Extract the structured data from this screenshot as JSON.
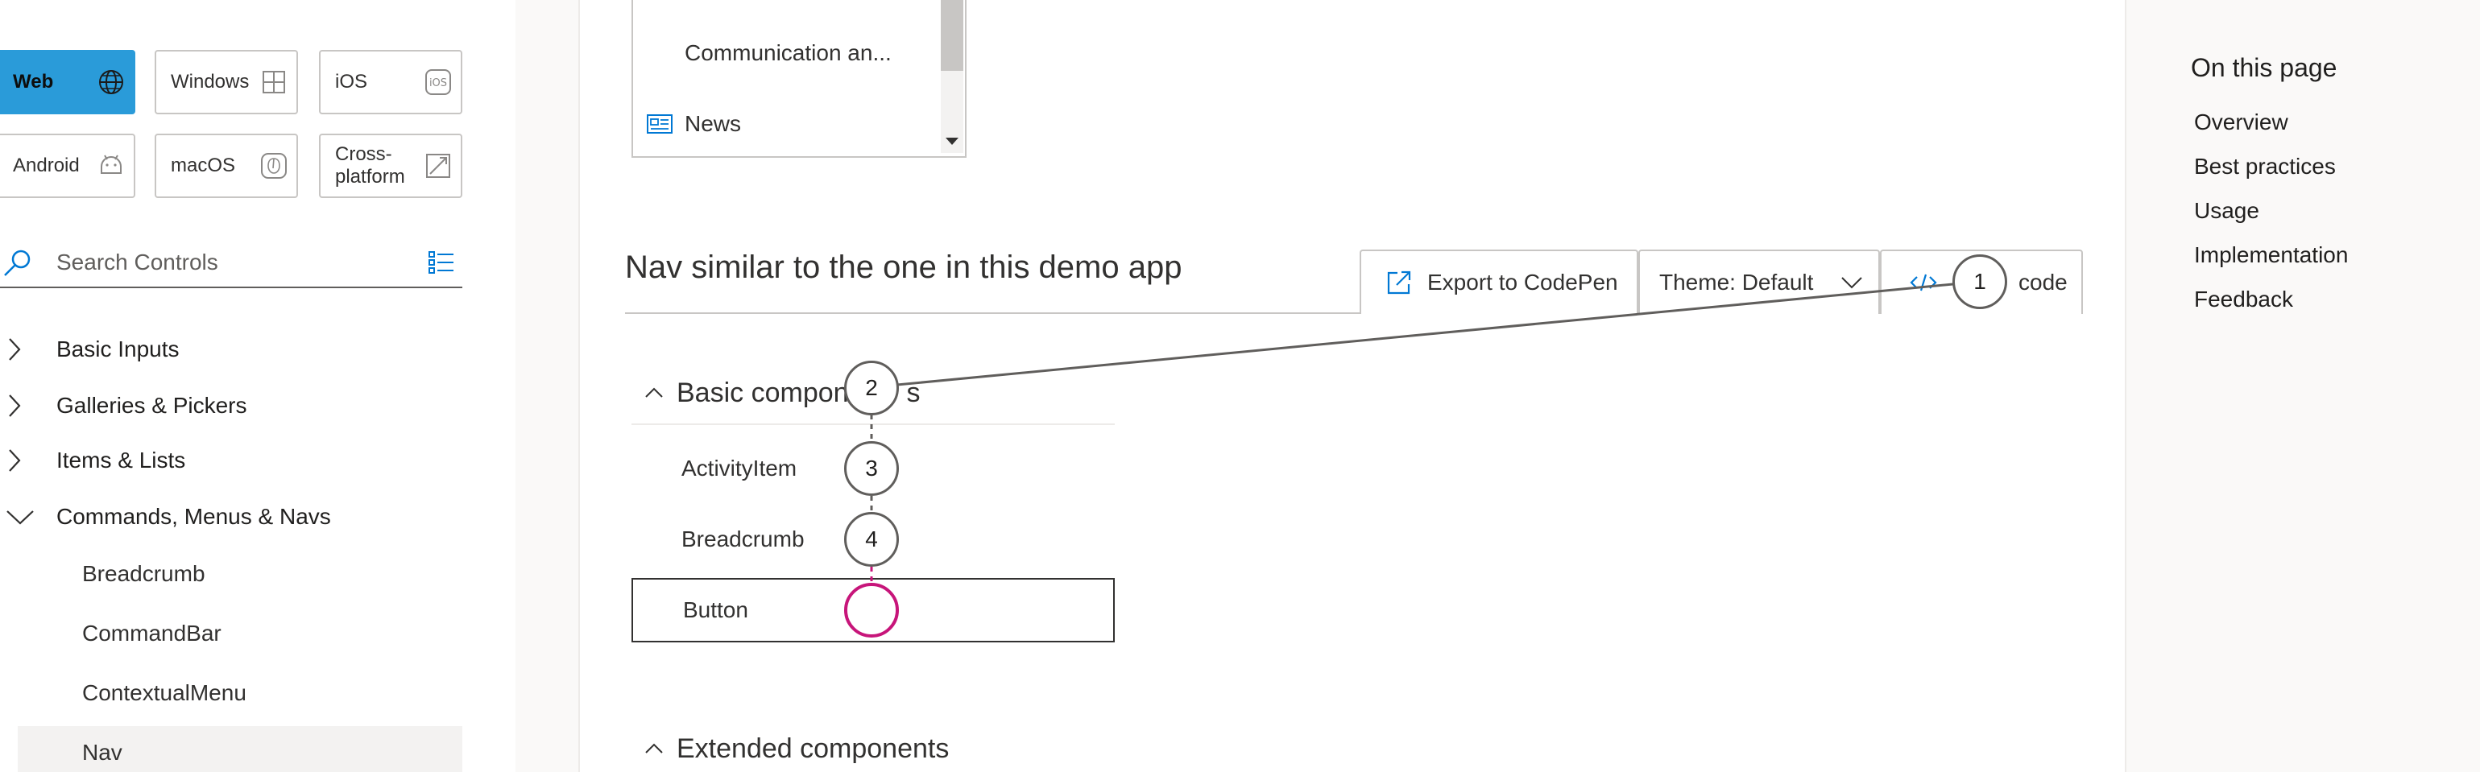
{
  "platforms": [
    {
      "label": "Web",
      "icon": "globe-icon",
      "active": true
    },
    {
      "label": "Windows",
      "icon": "windows-icon",
      "active": false
    },
    {
      "label": "iOS",
      "icon": "ios-icon",
      "active": false
    },
    {
      "label": "Android",
      "icon": "android-icon",
      "active": false
    },
    {
      "label": "macOS",
      "icon": "macos-icon",
      "active": false
    },
    {
      "label": "Cross-platform",
      "line1": "Cross-",
      "line2": "platform",
      "icon": "cross-platform-icon",
      "active": false
    }
  ],
  "search": {
    "placeholder": "Search Controls"
  },
  "tree": {
    "categories": [
      {
        "label": "Basic Inputs",
        "expanded": false
      },
      {
        "label": "Galleries & Pickers",
        "expanded": false
      },
      {
        "label": "Items & Lists",
        "expanded": false
      },
      {
        "label": "Commands, Menus & Navs",
        "expanded": true
      }
    ],
    "children": [
      {
        "label": "Breadcrumb"
      },
      {
        "label": "CommandBar"
      },
      {
        "label": "ContextualMenu"
      },
      {
        "label": "Nav",
        "selected": true
      }
    ]
  },
  "demo_list": {
    "items": [
      {
        "label": "Communication an..."
      },
      {
        "label": "News",
        "icon": "news-icon"
      }
    ]
  },
  "section": {
    "title": "Nav similar to the one in this demo app"
  },
  "toolbar": {
    "export_label": "Export to CodePen",
    "theme_label": "Theme: Default",
    "show_code_label": "Show code",
    "show_code_visible_tail": "code"
  },
  "nav_demo": {
    "group1": "Basic components",
    "group1_visible": "Basic compon",
    "group1_tail": "s",
    "links": [
      "ActivityItem",
      "Breadcrumb",
      "Button"
    ],
    "group2": "Extended components"
  },
  "annotations": {
    "markers": [
      "1",
      "2",
      "3",
      "4",
      ""
    ]
  },
  "rail": {
    "title": "On this page",
    "links": [
      "Overview",
      "Best practices",
      "Usage",
      "Implementation",
      "Feedback"
    ]
  },
  "colors": {
    "accent": "#2a9bd9",
    "link_blue": "#0078d4",
    "target_marker": "#c7157a"
  }
}
